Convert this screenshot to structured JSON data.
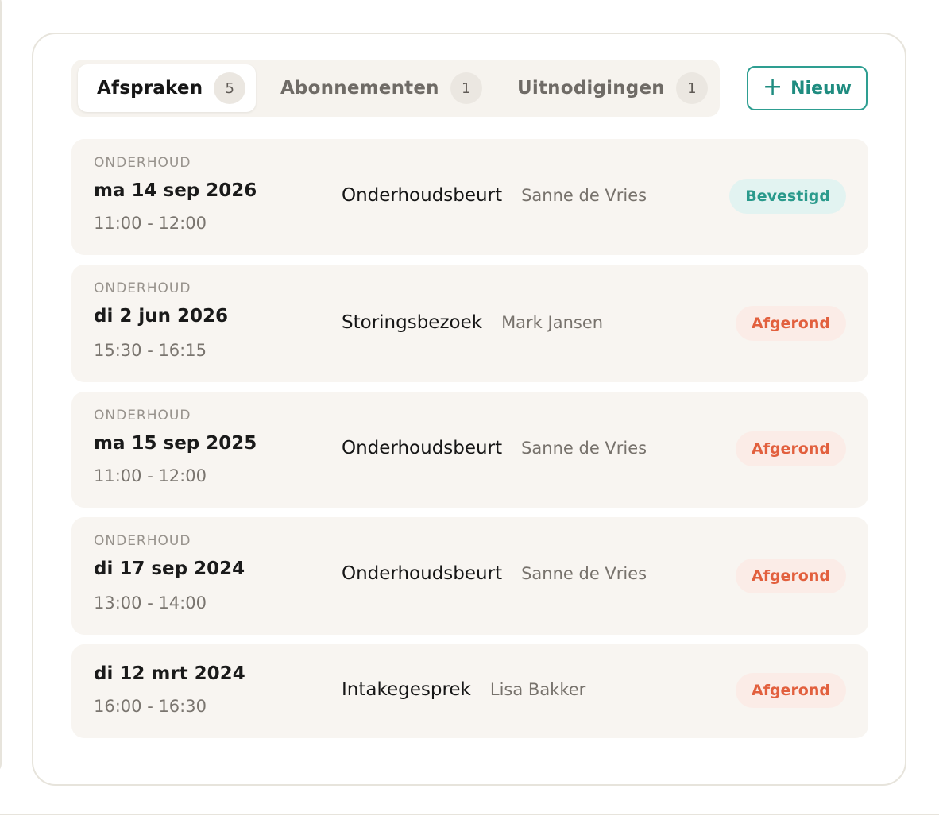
{
  "tabs": [
    {
      "label": "Afspraken",
      "count": "5"
    },
    {
      "label": "Abonnementen",
      "count": "1"
    },
    {
      "label": "Uitnodigingen",
      "count": "1"
    }
  ],
  "new_button": {
    "icon": "plus-icon",
    "label": "Nieuw"
  },
  "colors": {
    "accent": "#2e9e91",
    "confirmed_text": "#2a9a8c",
    "confirmed_bg": "#e2f3f1",
    "done_text": "#e2603e",
    "done_bg": "#fbece7",
    "row_bg": "#f8f5f1"
  },
  "appointments": [
    {
      "category": "ONDERHOUD",
      "date": "ma 14 sep 2026",
      "time": "11:00 - 12:00",
      "type": "Onderhoudsbeurt",
      "person": "Sanne de Vries",
      "status": "Bevestigd"
    },
    {
      "category": "ONDERHOUD",
      "date": "di 2 jun 2026",
      "time": "15:30 - 16:15",
      "type": "Storingsbezoek",
      "person": "Mark Jansen",
      "status": "Afgerond"
    },
    {
      "category": "ONDERHOUD",
      "date": "ma 15 sep 2025",
      "time": "11:00 - 12:00",
      "type": "Onderhoudsbeurt",
      "person": "Sanne de Vries",
      "status": "Afgerond"
    },
    {
      "category": "ONDERHOUD",
      "date": "di 17 sep 2024",
      "time": "13:00 - 14:00",
      "type": "Onderhoudsbeurt",
      "person": "Sanne de Vries",
      "status": "Afgerond"
    },
    {
      "date": "di 12 mrt 2024",
      "time": "16:00 - 16:30",
      "type": "Intakegesprek",
      "person": "Lisa Bakker",
      "status": "Afgerond"
    }
  ]
}
